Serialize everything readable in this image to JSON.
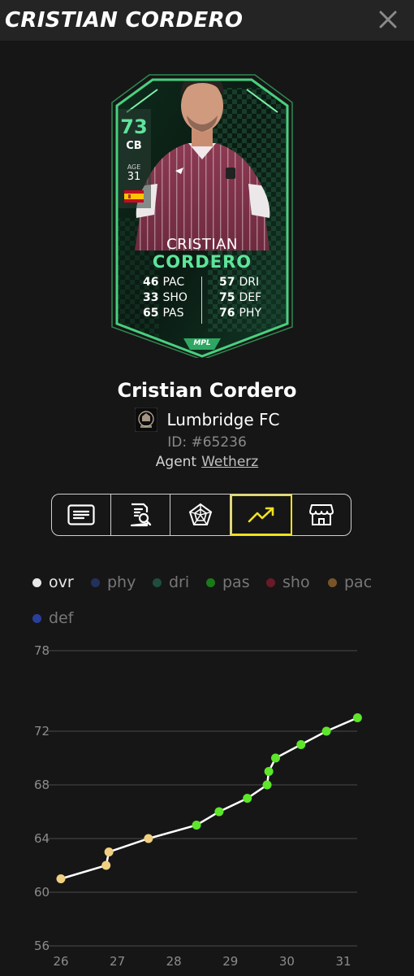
{
  "header": {
    "title": "CRISTIAN CORDERO"
  },
  "card": {
    "ovr": "73",
    "position": "CB",
    "age_label": "AGE",
    "age": "31",
    "first_name": "CRISTIAN",
    "last_name": "CORDERO",
    "logo_text": "MPL",
    "stats": [
      {
        "value": "46",
        "label": "PAC"
      },
      {
        "value": "33",
        "label": "SHO"
      },
      {
        "value": "65",
        "label": "PAS"
      },
      {
        "value": "57",
        "label": "DRI"
      },
      {
        "value": "75",
        "label": "DEF"
      },
      {
        "value": "76",
        "label": "PHY"
      }
    ],
    "accent_color": "#5fe49a"
  },
  "player": {
    "name": "Cristian Cordero",
    "club": "Lumbridge FC",
    "id": "ID: #65236",
    "agent_label": "Agent",
    "agent_name": "Wetherz"
  },
  "tabs": [
    {
      "icon": "details-icon"
    },
    {
      "icon": "scout-report-icon"
    },
    {
      "icon": "attributes-radar-icon"
    },
    {
      "icon": "progression-chart-icon",
      "active": true
    },
    {
      "icon": "market-icon"
    }
  ],
  "legend": [
    {
      "label": "ovr",
      "color": "#e8e8e8"
    },
    {
      "label": "phy",
      "color": "#23305c"
    },
    {
      "label": "dri",
      "color": "#1f4d3e"
    },
    {
      "label": "pas",
      "color": "#1a7a1a"
    },
    {
      "label": "sho",
      "color": "#6a1a26"
    },
    {
      "label": "pac",
      "color": "#7a5428"
    },
    {
      "label": "def",
      "color": "#2a3f9c"
    }
  ],
  "chart_data": {
    "type": "line",
    "series": [
      {
        "name": "ovr",
        "points": [
          {
            "x": 26.0,
            "y": 61
          },
          {
            "x": 26.8,
            "y": 62
          },
          {
            "x": 26.85,
            "y": 63
          },
          {
            "x": 27.55,
            "y": 64
          },
          {
            "x": 28.4,
            "y": 65
          },
          {
            "x": 28.8,
            "y": 66
          },
          {
            "x": 29.3,
            "y": 67
          },
          {
            "x": 29.65,
            "y": 68
          },
          {
            "x": 29.68,
            "y": 69
          },
          {
            "x": 29.8,
            "y": 70
          },
          {
            "x": 30.25,
            "y": 71
          },
          {
            "x": 30.7,
            "y": 72
          },
          {
            "x": 31.25,
            "y": 73
          }
        ],
        "line_color": "#ffffff",
        "point_colors": [
          "#f0d080",
          "#f0d080",
          "#f0d080",
          "#f0d080",
          "#5ee62a",
          "#5ee62a",
          "#5ee62a",
          "#5ee62a",
          "#5ee62a",
          "#5ee62a",
          "#5ee62a",
          "#5ee62a",
          "#5ee62a"
        ]
      }
    ],
    "xlim": [
      26,
      31.3
    ],
    "ylim": [
      56,
      78
    ],
    "x_ticks": [
      "26",
      "27",
      "28",
      "29",
      "30",
      "31"
    ],
    "y_ticks": [
      "78",
      "72",
      "68",
      "64",
      "60",
      "56"
    ],
    "grid": true
  }
}
